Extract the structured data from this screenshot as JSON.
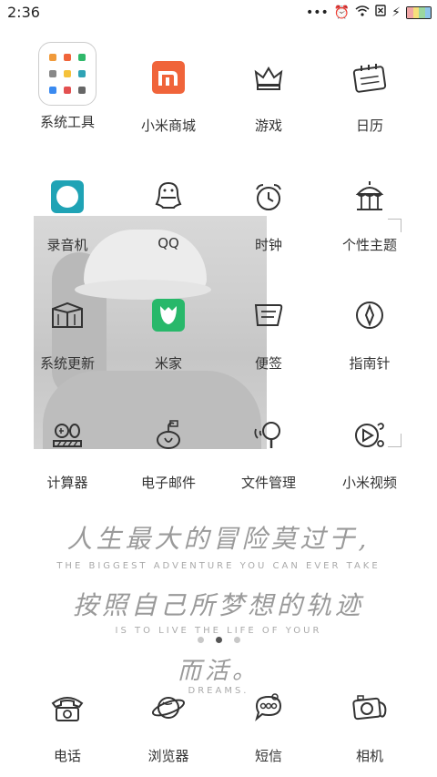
{
  "status": {
    "time": "2:36"
  },
  "apps_row1": [
    "系统工具",
    "小米商城",
    "游戏",
    "日历"
  ],
  "apps_row2": [
    "录音机",
    "QQ",
    "时钟",
    "个性主题"
  ],
  "apps_row3": [
    "系统更新",
    "米家",
    "便签",
    "指南针"
  ],
  "apps_row4": [
    "计算器",
    "电子邮件",
    "文件管理",
    "小米视频"
  ],
  "dock": [
    "电话",
    "浏览器",
    "短信",
    "相机"
  ],
  "wallpaper": {
    "line1": "人生最大的冒险莫过于,",
    "line2": "THE BIGGEST ADVENTURE YOU CAN EVER TAKE",
    "line3": "按照自己所梦想的轨迹",
    "line4": "IS TO LIVE THE LIFE OF YOUR",
    "line5": "而活。",
    "line6": "DREAMS."
  },
  "page_indicator": {
    "pages": 3,
    "current": 2
  },
  "colors": {
    "mi_orange": "#f0643a",
    "recorder_teal": "#1fa3b5",
    "mijia_green": "#28b86a"
  }
}
